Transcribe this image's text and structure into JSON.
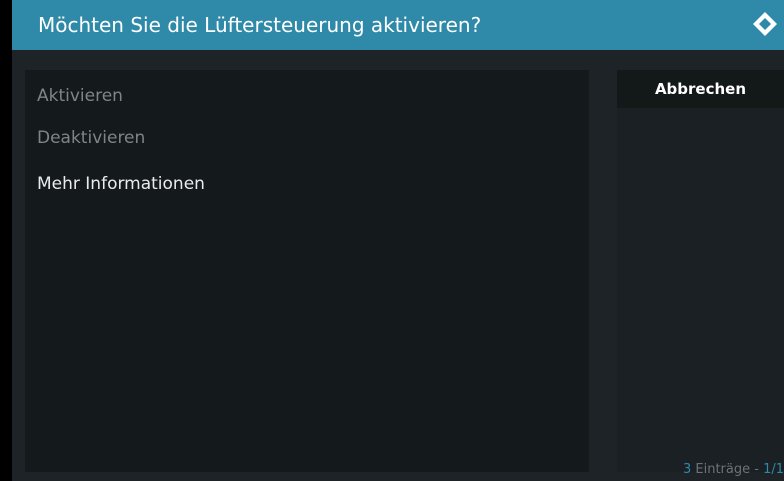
{
  "dialog": {
    "title": "Möchten Sie die Lüftersteuerung aktivieren?",
    "logo_icon": "kodi-logo-icon"
  },
  "options": [
    {
      "label": "Aktivieren",
      "state": "dimmed"
    },
    {
      "label": "Deaktivieren",
      "state": "dimmed"
    },
    {
      "label": "Mehr Informationen",
      "state": "normal"
    }
  ],
  "side": {
    "cancel_label": "Abbrechen"
  },
  "footer": {
    "count": "3",
    "entries_label": " Einträge - ",
    "page": "1/1"
  },
  "colors": {
    "header": "#2e8aa8",
    "accent": "#2e8aa8",
    "background": "#1d2326"
  }
}
